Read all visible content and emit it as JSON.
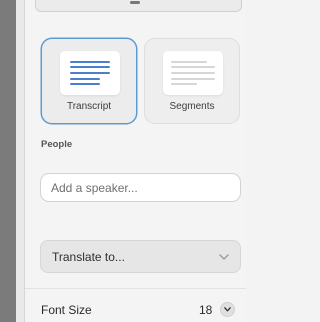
{
  "modes": [
    {
      "label": "Transcript",
      "selected": true
    },
    {
      "label": "Segments",
      "selected": false
    }
  ],
  "people": {
    "section_label": "People",
    "speaker_placeholder": "Add a speaker..."
  },
  "translate": {
    "selected_label": "Translate to..."
  },
  "font_size": {
    "label": "Font Size",
    "value": "18"
  },
  "colors": {
    "accent": "#5b9bd5",
    "transcript_line": "#4a7fd0",
    "segments_line": "#d6d6d6"
  }
}
